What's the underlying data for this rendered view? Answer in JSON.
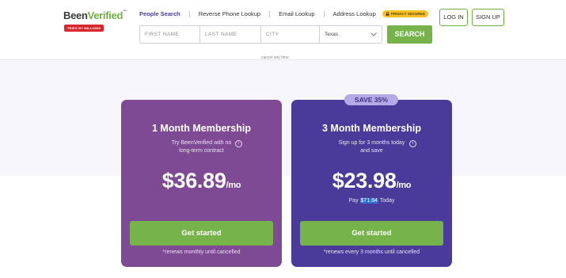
{
  "logo": {
    "text_a": "Been",
    "text_b": "Verified",
    "tm": "™",
    "badge": "TRIED BY MILLIONS"
  },
  "nav": {
    "items": [
      {
        "label": "People Search",
        "active": true
      },
      {
        "label": "Reverse Phone Lookup",
        "active": false
      },
      {
        "label": "Email Lookup",
        "active": false
      },
      {
        "label": "Address Lookup",
        "active": false
      }
    ],
    "privacy": "PRIVACY SECURED",
    "login": "LOG IN",
    "signup": "SIGN UP"
  },
  "search": {
    "first_name": "FIRST NAME",
    "last_name": "LAST NAME",
    "city": "CITY",
    "state": "Texas",
    "button": "SEARCH"
  },
  "cut_text": "cancel any time.",
  "plans": [
    {
      "title": "1 Month Membership",
      "desc_line1": "Try BeenVerified with no",
      "desc_line2": "long-term contract",
      "price": "$36.89",
      "per": "/mo",
      "cta": "Get started",
      "renew": "*renews monthly until cancelled"
    },
    {
      "badge": "SAVE 35%",
      "title": "3 Month Membership",
      "desc_line1": "Sign up for 3 months today",
      "desc_line2": "and save",
      "price": "$23.98",
      "per": "/mo",
      "pay_prefix": "Pay",
      "pay_amount": "$71.94",
      "pay_suffix": "Today",
      "cta": "Get started",
      "renew": "*renews every 3 months until cancelled"
    }
  ],
  "colors": {
    "brand_green": "#76b44b",
    "card_one": "#7e4a94",
    "card_three": "#4a3b9b",
    "logo_badge": "#d8262d",
    "privacy_badge": "#f6c026"
  }
}
